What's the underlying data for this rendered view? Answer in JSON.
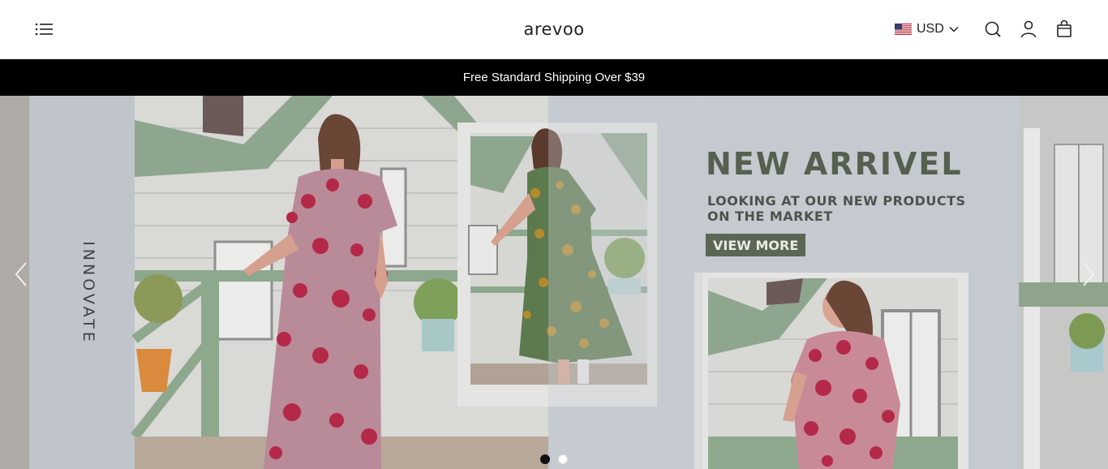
{
  "header": {
    "logo": "arevoo",
    "currency": "USD",
    "icons": [
      "menu-icon",
      "us-flag-icon",
      "chevron-down-icon",
      "search-icon",
      "account-icon",
      "cart-icon"
    ]
  },
  "announcement": "Free Standard Shipping Over $39",
  "hero": {
    "side_text": "INNOVATE",
    "headline": "NEW ARRIVEL",
    "subline_1": "LOOKING AT OUR NEW PRODUCTS",
    "subline_2": "ON THE MARKET",
    "cta": "VIEW MORE",
    "slides": {
      "current": 1,
      "total": 2
    }
  },
  "colors": {
    "announcement_bg": "#000000",
    "headline": "#56604f",
    "cta_bg": "#5c6655",
    "dress_pink": "#b98a98",
    "dress_green": "#5d7a4e"
  }
}
